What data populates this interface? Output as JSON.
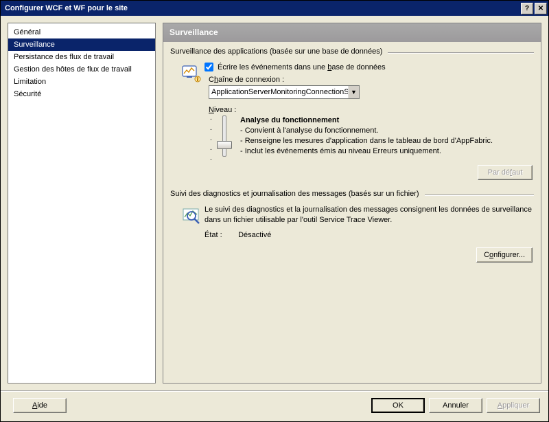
{
  "title": "Configurer WCF et WF pour le site",
  "sidebar": {
    "items": [
      {
        "label": "Général"
      },
      {
        "label": "Surveillance"
      },
      {
        "label": "Persistance des flux de travail"
      },
      {
        "label": "Gestion des hôtes de flux de travail"
      },
      {
        "label": "Limitation"
      },
      {
        "label": "Sécurité"
      }
    ],
    "selected": 1
  },
  "main": {
    "heading": "Surveillance",
    "section1": {
      "title": "Surveillance des applications (basée sur une base de données)",
      "checkbox_checked": true,
      "checkbox_pre": "Écrire les événements dans une ",
      "checkbox_under": "b",
      "checkbox_post": "ase de données",
      "conn_pre": "C",
      "conn_under": "h",
      "conn_post": "aîne de connexion :",
      "conn_value": "ApplicationServerMonitoringConnectionSt",
      "level_pre": "",
      "level_under": "N",
      "level_post": "iveau :",
      "level_name": "Analyse du fonctionnement",
      "level_b1": "- Convient à l'analyse du fonctionnement.",
      "level_b2": "- Renseigne les mesures d'application dans le tableau de bord d'AppFabric.",
      "level_b3": "- Inclut les événements émis au niveau Erreurs uniquement.",
      "default_pre": "Par dé",
      "default_under": "f",
      "default_post": "aut"
    },
    "section2": {
      "title": "Suivi des diagnostics et journalisation des messages (basés sur un fichier)",
      "desc": "Le suivi des diagnostics et la journalisation des messages consignent les données de surveillance dans un fichier utilisable par l'outil Service Trace Viewer.",
      "state_label": "État :",
      "state_value": "Désactivé",
      "config_pre": "C",
      "config_under": "o",
      "config_post": "nfigurer..."
    }
  },
  "footer": {
    "help_under": "A",
    "help_post": "ide",
    "ok": "OK",
    "cancel": "Annuler",
    "apply_under": "A",
    "apply_post": "ppliquer"
  }
}
